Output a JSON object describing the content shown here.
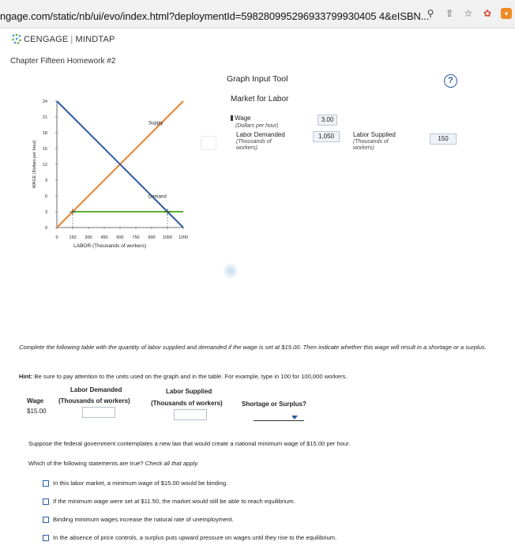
{
  "browser": {
    "url": "ngage.com/static/nb/ui/evo/index.html?deploymentId=598280995296933799930405 4&eISBN...",
    "icons": [
      "zoom-icon",
      "share-icon",
      "bookmark-star-icon",
      "extension-bird-icon",
      "extension-orange-icon"
    ]
  },
  "app": {
    "brand_primary": "CENGAGE",
    "brand_separator": "|",
    "brand_secondary": "MINDTAP",
    "chapter_title": "Chapter Fifteen Homework #2"
  },
  "graph_tool": {
    "title": "Graph Input Tool",
    "help_label": "?",
    "subtitle": "Market for Labor",
    "wage_label": "Wage",
    "wage_unit": "(Dollars per hour)",
    "wage_value": "3.00",
    "demanded_label": "Labor Demanded",
    "demanded_unit": "(Thousands of workers)",
    "demanded_value": "1,050",
    "supplied_label": "Labor Supplied",
    "supplied_unit": "(Thousands of workers)",
    "supplied_value": "150"
  },
  "chart_data": {
    "type": "line",
    "xlabel": "LABOR (Thousands of workers)",
    "ylabel": "WAGE (Dollars per hour)",
    "x_ticks": [
      0,
      150,
      300,
      450,
      600,
      750,
      900,
      1050,
      1200
    ],
    "y_ticks": [
      0,
      3,
      6,
      9,
      12,
      15,
      18,
      21,
      24
    ],
    "xlim": [
      0,
      1200
    ],
    "ylim": [
      0,
      24
    ],
    "series": [
      {
        "name": "Supply",
        "color": "#e8822e",
        "points": [
          [
            0,
            0
          ],
          [
            1200,
            24
          ]
        ]
      },
      {
        "name": "Demand",
        "color": "#2c5aa8",
        "points": [
          [
            0,
            24
          ],
          [
            1200,
            0
          ]
        ]
      }
    ],
    "horizontal_line": {
      "y": 3,
      "color": "#5cb030",
      "x_range": [
        150,
        1200
      ]
    },
    "markers": [
      [
        150,
        3
      ],
      [
        1050,
        3
      ]
    ],
    "curve_labels": {
      "supply": "Supply",
      "demand": "Demand"
    }
  },
  "question": {
    "instructions": "Complete the following table with the quantity of labor supplied and demanded if the wage is set at $15.00. Then indicate whether this wage will result in a shortage or a surplus.",
    "hint_label": "Hint:",
    "hint_text": "Be sure to pay attention to the units used on the graph and in the table. For example, type in 100 for 100,000 workers.",
    "table": {
      "col_demanded": "Labor Demanded",
      "col_supplied": "Labor Supplied",
      "col_wage": "Wage",
      "col_demanded_unit": "(Thousands of workers)",
      "col_supplied_unit": "(Thousands of workers)",
      "col_result": "Shortage or Surplus?",
      "row_wage": "$15.00",
      "demanded_input": "",
      "supplied_input": "",
      "result_select": ""
    },
    "scenario": "Suppose the federal government contemplates a new law that would create a national minimum wage of $15.00 per hour.",
    "prompt_main": "Which of the following statements are true?",
    "prompt_hint": "Check all that apply.",
    "options": [
      "In this labor market, a minimum wage of $15.00 would be binding.",
      "If the minimum wage were set at $11.50, the market would still be able to reach equilibrium.",
      "Binding minimum wages increase the natural rate of unemployment.",
      "In the absence of price controls, a surplus puts upward pressure on wages until they rise to the equilibrium."
    ]
  }
}
